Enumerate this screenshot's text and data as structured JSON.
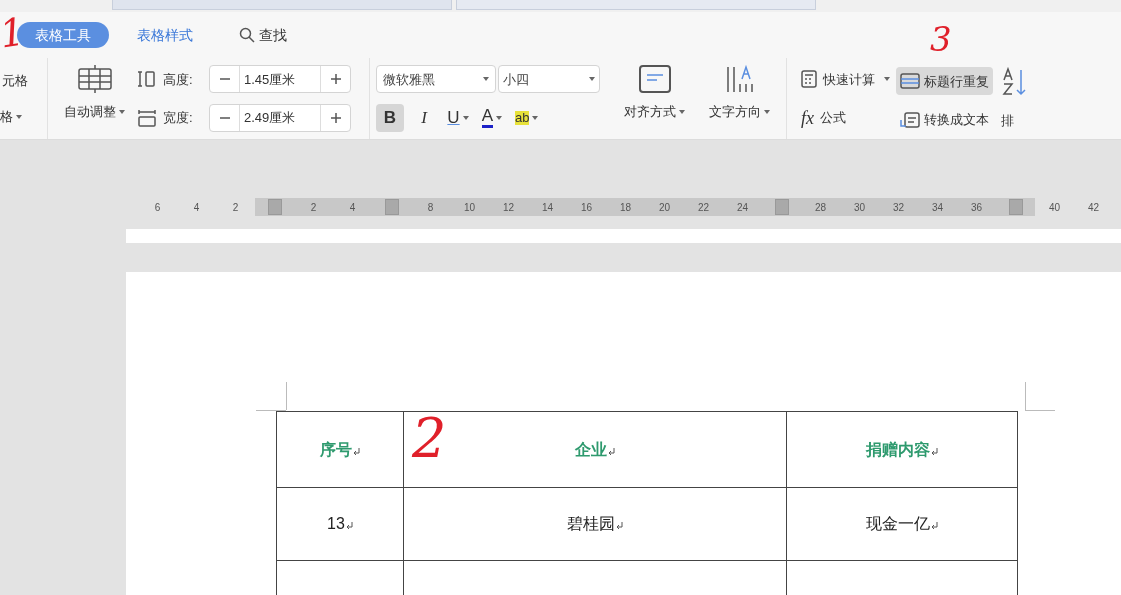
{
  "tabs": [
    {
      "label": "表格工具",
      "selected": true
    },
    {
      "label": "表格样式",
      "selected": false
    },
    {
      "label": "查找",
      "selected": false
    }
  ],
  "ribbon": {
    "cut_left": [
      "元格",
      "格"
    ],
    "auto_adjust": "自动调整",
    "height": {
      "label": "高度:",
      "value": "1.45厘米"
    },
    "width": {
      "label": "宽度:",
      "value": "2.49厘米"
    },
    "font": {
      "value": "微软雅黑"
    },
    "size": {
      "value": "小四"
    },
    "format_buttons": [
      {
        "label": "B",
        "selected": true
      },
      {
        "label": "I",
        "selected": false
      },
      {
        "label": "U",
        "selected": false
      },
      {
        "label": "A",
        "selected": false
      },
      {
        "label": "ab",
        "selected": false
      }
    ],
    "align": "对齐方式",
    "direction": "文字方向",
    "quick_calc": "快速计算",
    "formula_fx": "fx",
    "formula": "公式",
    "repeat_header": {
      "label": "标题行重复",
      "selected": true
    },
    "to_text": "转换成文本",
    "sort": "排"
  },
  "ruler": [
    {
      "kind": "number",
      "label": "6"
    },
    {
      "kind": "number",
      "label": "4"
    },
    {
      "kind": "number",
      "label": "2"
    },
    {
      "kind": "marker"
    },
    {
      "kind": "number",
      "label": "2"
    },
    {
      "kind": "number",
      "label": "4"
    },
    {
      "kind": "marker"
    },
    {
      "kind": "number",
      "label": "8"
    },
    {
      "kind": "number",
      "label": "10"
    },
    {
      "kind": "number",
      "label": "12"
    },
    {
      "kind": "number",
      "label": "14"
    },
    {
      "kind": "number",
      "label": "16"
    },
    {
      "kind": "number",
      "label": "18"
    },
    {
      "kind": "number",
      "label": "20"
    },
    {
      "kind": "number",
      "label": "22"
    },
    {
      "kind": "number",
      "label": "24"
    },
    {
      "kind": "marker"
    },
    {
      "kind": "number",
      "label": "28"
    },
    {
      "kind": "number",
      "label": "30"
    },
    {
      "kind": "number",
      "label": "32"
    },
    {
      "kind": "number",
      "label": "34"
    },
    {
      "kind": "number",
      "label": "36"
    },
    {
      "kind": "marker"
    },
    {
      "kind": "number",
      "label": "40"
    },
    {
      "kind": "number",
      "label": "42"
    }
  ],
  "table": {
    "columns": [
      "序号",
      "企业",
      "捐赠内容"
    ],
    "rows": [
      [
        "13",
        "碧桂园",
        "现金一亿"
      ]
    ]
  },
  "annotations": [
    "1",
    "2",
    "3"
  ]
}
